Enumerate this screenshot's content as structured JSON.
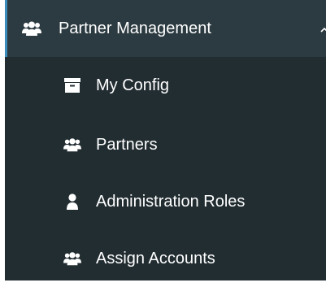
{
  "sidebar": {
    "group": {
      "label": "Partner Management",
      "icon": "users-icon",
      "expanded": true,
      "chevron": "chevron-up-icon"
    },
    "items": [
      {
        "label": "My Config",
        "icon": "archive-box-icon"
      },
      {
        "label": "Partners",
        "icon": "users-icon"
      },
      {
        "label": "Administration Roles",
        "icon": "user-icon"
      },
      {
        "label": "Assign Accounts",
        "icon": "users-icon"
      }
    ]
  },
  "colors": {
    "sidebar_bg": "#222d32",
    "header_bg": "#2c3b41",
    "accent": "#3c8dbc",
    "text": "#ffffff"
  }
}
